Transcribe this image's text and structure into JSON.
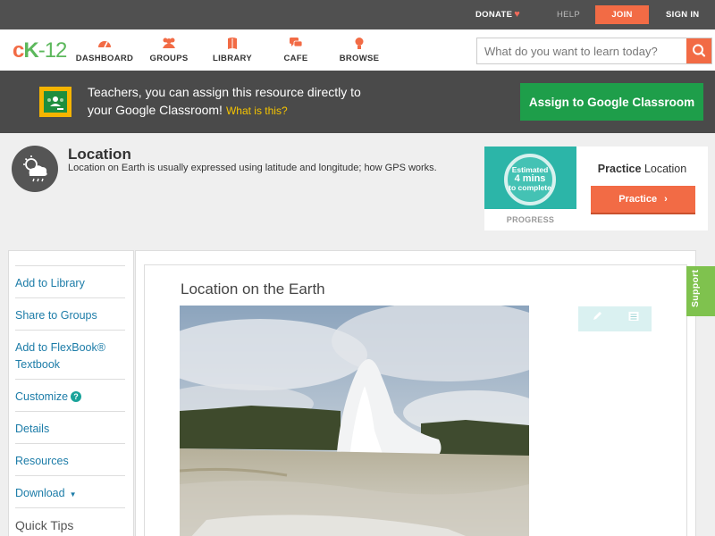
{
  "topbar": {
    "donate": "DONATE",
    "help": "HELP",
    "join": "JOIN",
    "sign_in": "SIGN IN"
  },
  "nav": {
    "items": [
      {
        "label": "DASHBOARD",
        "icon": "dashboard-icon"
      },
      {
        "label": "GROUPS",
        "icon": "groups-icon"
      },
      {
        "label": "LIBRARY",
        "icon": "library-icon"
      },
      {
        "label": "CAFE",
        "icon": "cafe-icon"
      },
      {
        "label": "BROWSE",
        "icon": "browse-icon"
      }
    ],
    "search_placeholder": "What do you want to learn today?"
  },
  "banner": {
    "line1": "Teachers, you can assign this resource directly to",
    "line2": "your Google Classroom!",
    "what_link": "What is this?",
    "button": "Assign to Google Classroom"
  },
  "lesson": {
    "title": "Location",
    "description": "Location on Earth is usually expressed using latitude and longitude; how GPS works.",
    "icon": "weather-icon"
  },
  "practice_card": {
    "progress_line1": "Estimated",
    "progress_mins": "4 mins",
    "progress_line3": "to complete",
    "progress_label": "PROGRESS",
    "title_bold": "Practice",
    "title_rest": "Location",
    "button": "Practice"
  },
  "sidebar": {
    "add_library": "Add to Library",
    "share_groups": "Share to Groups",
    "add_flexbook": "Add to FlexBook®",
    "add_flexbook_line2": "Textbook",
    "customize": "Customize",
    "details": "Details",
    "resources": "Resources",
    "download": "Download",
    "quick_tips": "Quick Tips"
  },
  "content": {
    "title": "Location on the Earth",
    "support": "Support"
  },
  "colors": {
    "accent": "#f26b45",
    "brand_green": "#5cb85c",
    "classroom_green": "#1e9e4a",
    "link": "#1c7ca8"
  }
}
